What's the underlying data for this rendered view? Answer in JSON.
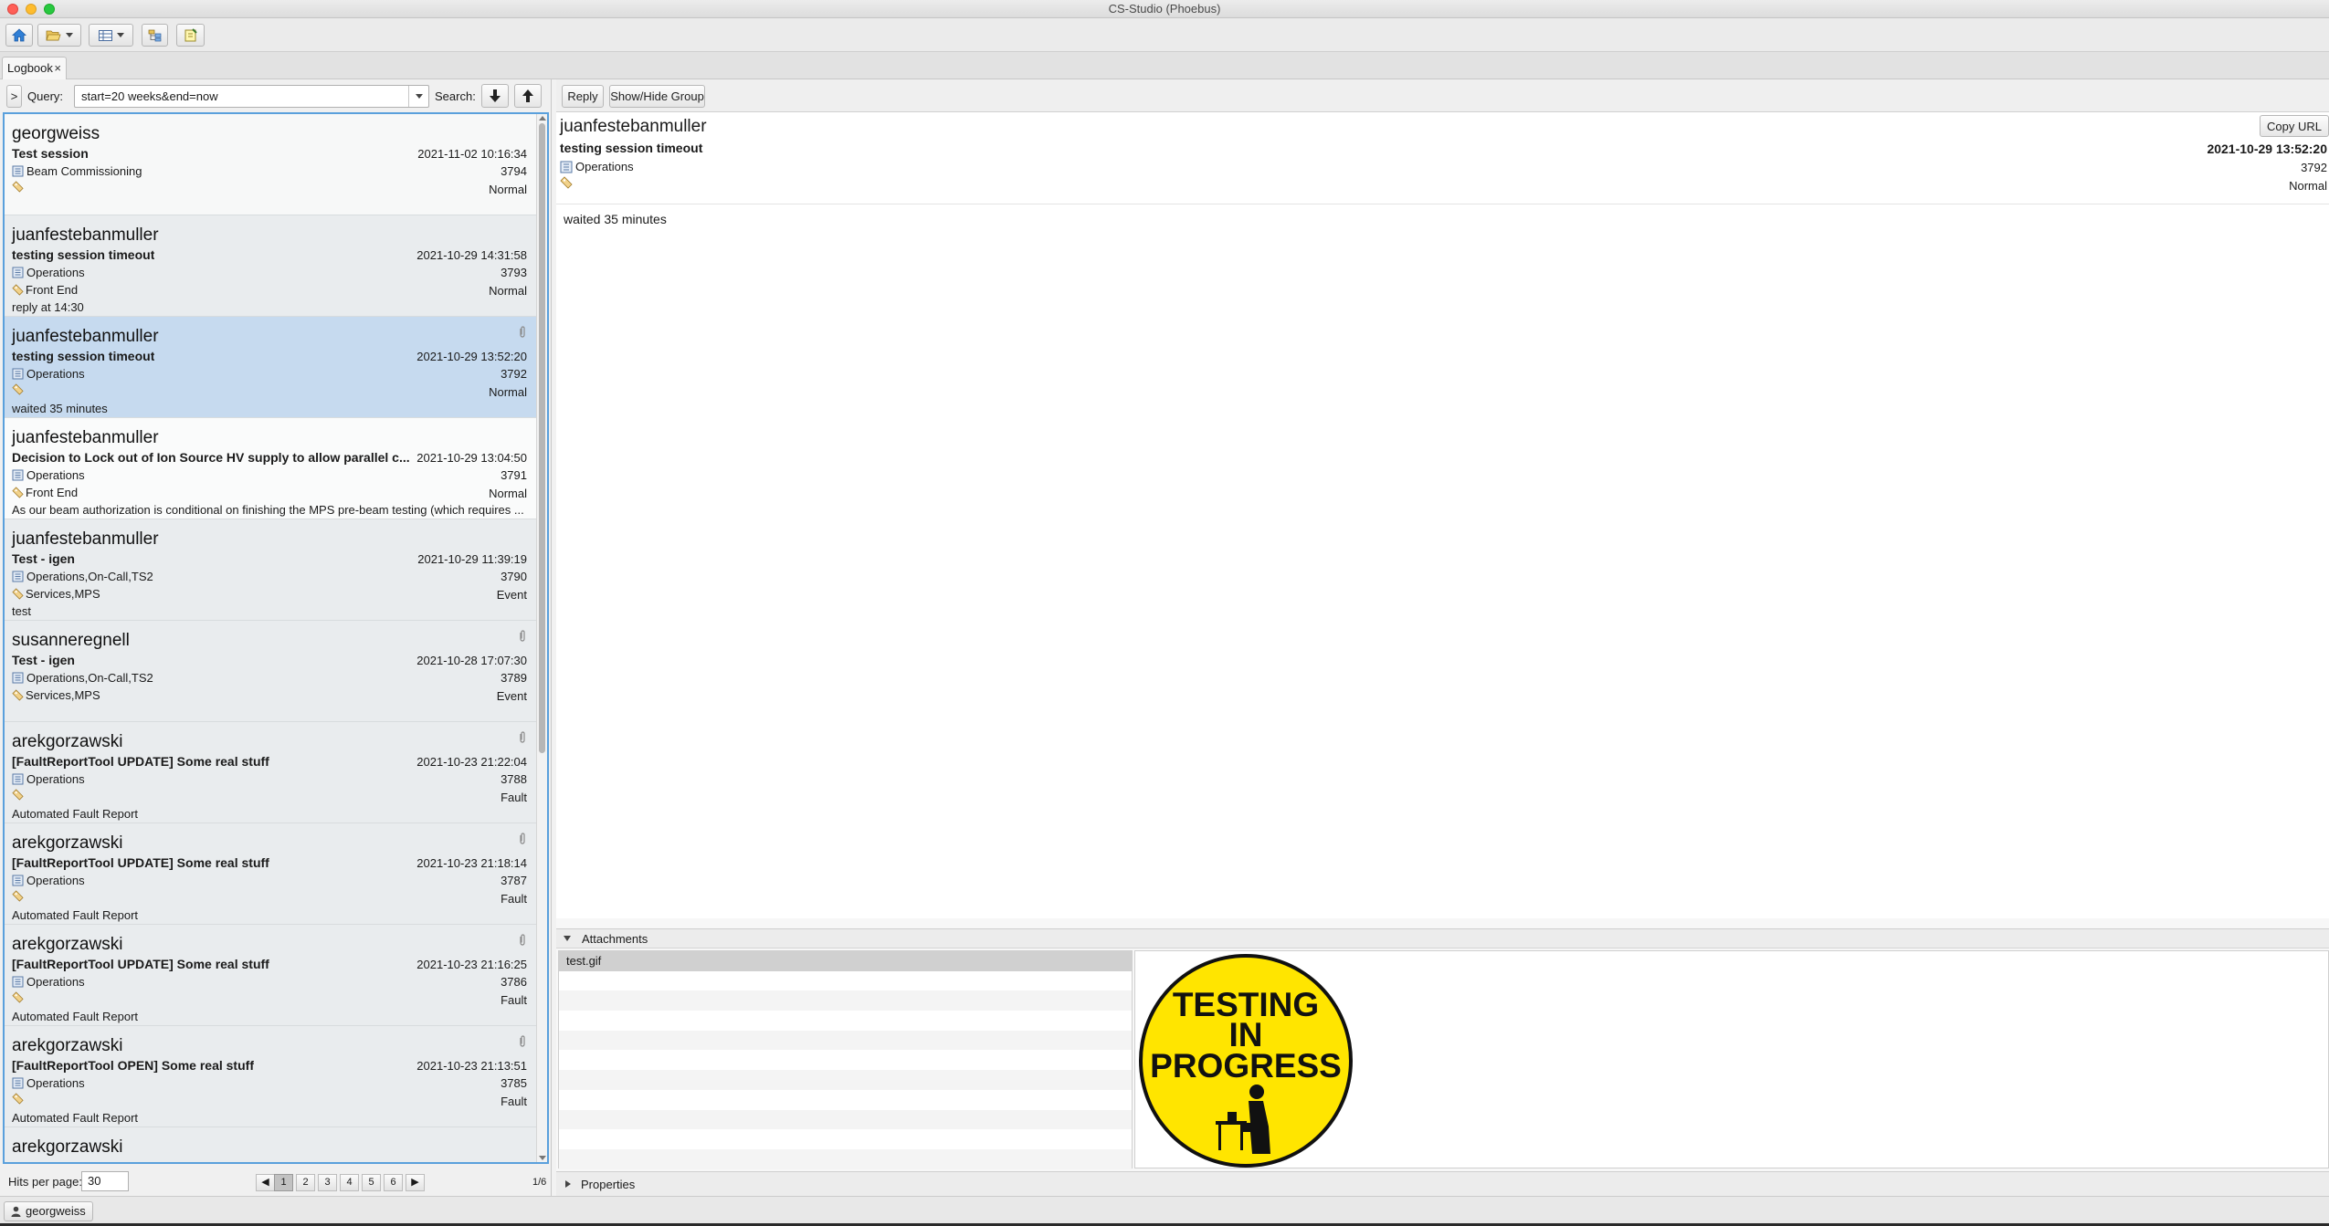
{
  "window": {
    "title": "CS-Studio (Phoebus)"
  },
  "toolbar": {
    "icons": [
      "home-icon",
      "open-folder-icon",
      "layout-icon",
      "hierarchy-icon",
      "note-icon"
    ]
  },
  "tabs": [
    {
      "label": "Logbook",
      "close": "×"
    }
  ],
  "query": {
    "expand_label": ">",
    "query_label": "Query:",
    "query_value": "start=20 weeks&end=now",
    "search_label": "Search:"
  },
  "entries": [
    {
      "owner": "georgweiss",
      "title": "Test session",
      "date": "2021-11-02 10:16:34",
      "logbooks": "Beam Commissioning",
      "id": "3794",
      "tags": "",
      "level": "Normal",
      "desc": "",
      "attachment": false
    },
    {
      "owner": "juanfestebanmuller",
      "title": "testing session timeout",
      "date": "2021-10-29 14:31:58",
      "logbooks": "Operations",
      "id": "3793",
      "tags": "Front End",
      "level": "Normal",
      "desc": "reply at 14:30",
      "attachment": false
    },
    {
      "owner": "juanfestebanmuller",
      "title": "testing session timeout",
      "date": "2021-10-29 13:52:20",
      "logbooks": "Operations",
      "id": "3792",
      "tags": "",
      "level": "Normal",
      "desc": "waited 35 minutes",
      "attachment": true
    },
    {
      "owner": "juanfestebanmuller",
      "title": "Decision to Lock out of Ion Source HV supply to allow parallel c...",
      "date": "2021-10-29 13:04:50",
      "logbooks": "Operations",
      "id": "3791",
      "tags": "Front End",
      "level": "Normal",
      "desc": "As our beam authorization is conditional on finishing the MPS pre-beam testing (which requires ...",
      "attachment": false
    },
    {
      "owner": "juanfestebanmuller",
      "title": "Test - igen",
      "date": "2021-10-29 11:39:19",
      "logbooks": "Operations,On-Call,TS2",
      "id": "3790",
      "tags": "Services,MPS",
      "level": "Event",
      "desc": "test",
      "attachment": false
    },
    {
      "owner": "susanneregnell",
      "title": "Test - igen",
      "date": "2021-10-28 17:07:30",
      "logbooks": "Operations,On-Call,TS2",
      "id": "3789",
      "tags": "Services,MPS",
      "level": "Event",
      "desc": "",
      "attachment": true
    },
    {
      "owner": "arekgorzawski",
      "title": "[FaultReportTool UPDATE] Some real stuff",
      "date": "2021-10-23 21:22:04",
      "logbooks": "Operations",
      "id": "3788",
      "tags": "",
      "level": "Fault",
      "desc": "Automated Fault Report",
      "attachment": true
    },
    {
      "owner": "arekgorzawski",
      "title": "[FaultReportTool UPDATE] Some real stuff",
      "date": "2021-10-23 21:18:14",
      "logbooks": "Operations",
      "id": "3787",
      "tags": "",
      "level": "Fault",
      "desc": "Automated Fault Report",
      "attachment": true
    },
    {
      "owner": "arekgorzawski",
      "title": "[FaultReportTool UPDATE] Some real stuff",
      "date": "2021-10-23 21:16:25",
      "logbooks": "Operations",
      "id": "3786",
      "tags": "",
      "level": "Fault",
      "desc": "Automated Fault Report",
      "attachment": true
    },
    {
      "owner": "arekgorzawski",
      "title": "[FaultReportTool OPEN] Some real stuff",
      "date": "2021-10-23 21:13:51",
      "logbooks": "Operations",
      "id": "3785",
      "tags": "",
      "level": "Fault",
      "desc": "Automated Fault Report",
      "attachment": true
    },
    {
      "owner": "arekgorzawski",
      "title": "",
      "date": "",
      "logbooks": "",
      "id": "",
      "tags": "",
      "level": "",
      "desc": "",
      "attachment": false
    }
  ],
  "pager": {
    "hits_label": "Hits per page:",
    "hits_value": "30",
    "pages": [
      "1",
      "2",
      "3",
      "4",
      "5",
      "6"
    ],
    "current_page": "1",
    "count": "1/6",
    "prev": "◀",
    "next": "▶"
  },
  "detail": {
    "reply_label": "Reply",
    "show_hide_label": "Show/Hide Group",
    "copy_url_label": "Copy URL",
    "owner": "juanfestebanmuller",
    "title": "testing session timeout",
    "date": "2021-10-29 13:52:20",
    "logbooks": "Operations",
    "id": "3792",
    "level": "Normal",
    "body": "waited 35 minutes"
  },
  "attachments": {
    "header": "Attachments",
    "files": [
      "test.gif"
    ],
    "preview_text": [
      "TESTING",
      "IN",
      "PROGRESS"
    ]
  },
  "properties": {
    "header": "Properties"
  },
  "status": {
    "user": "georgweiss"
  },
  "colors": {
    "selection": "#c6daef",
    "focus_border": "#5aa0dc",
    "sign_yellow": "#ffe500"
  }
}
